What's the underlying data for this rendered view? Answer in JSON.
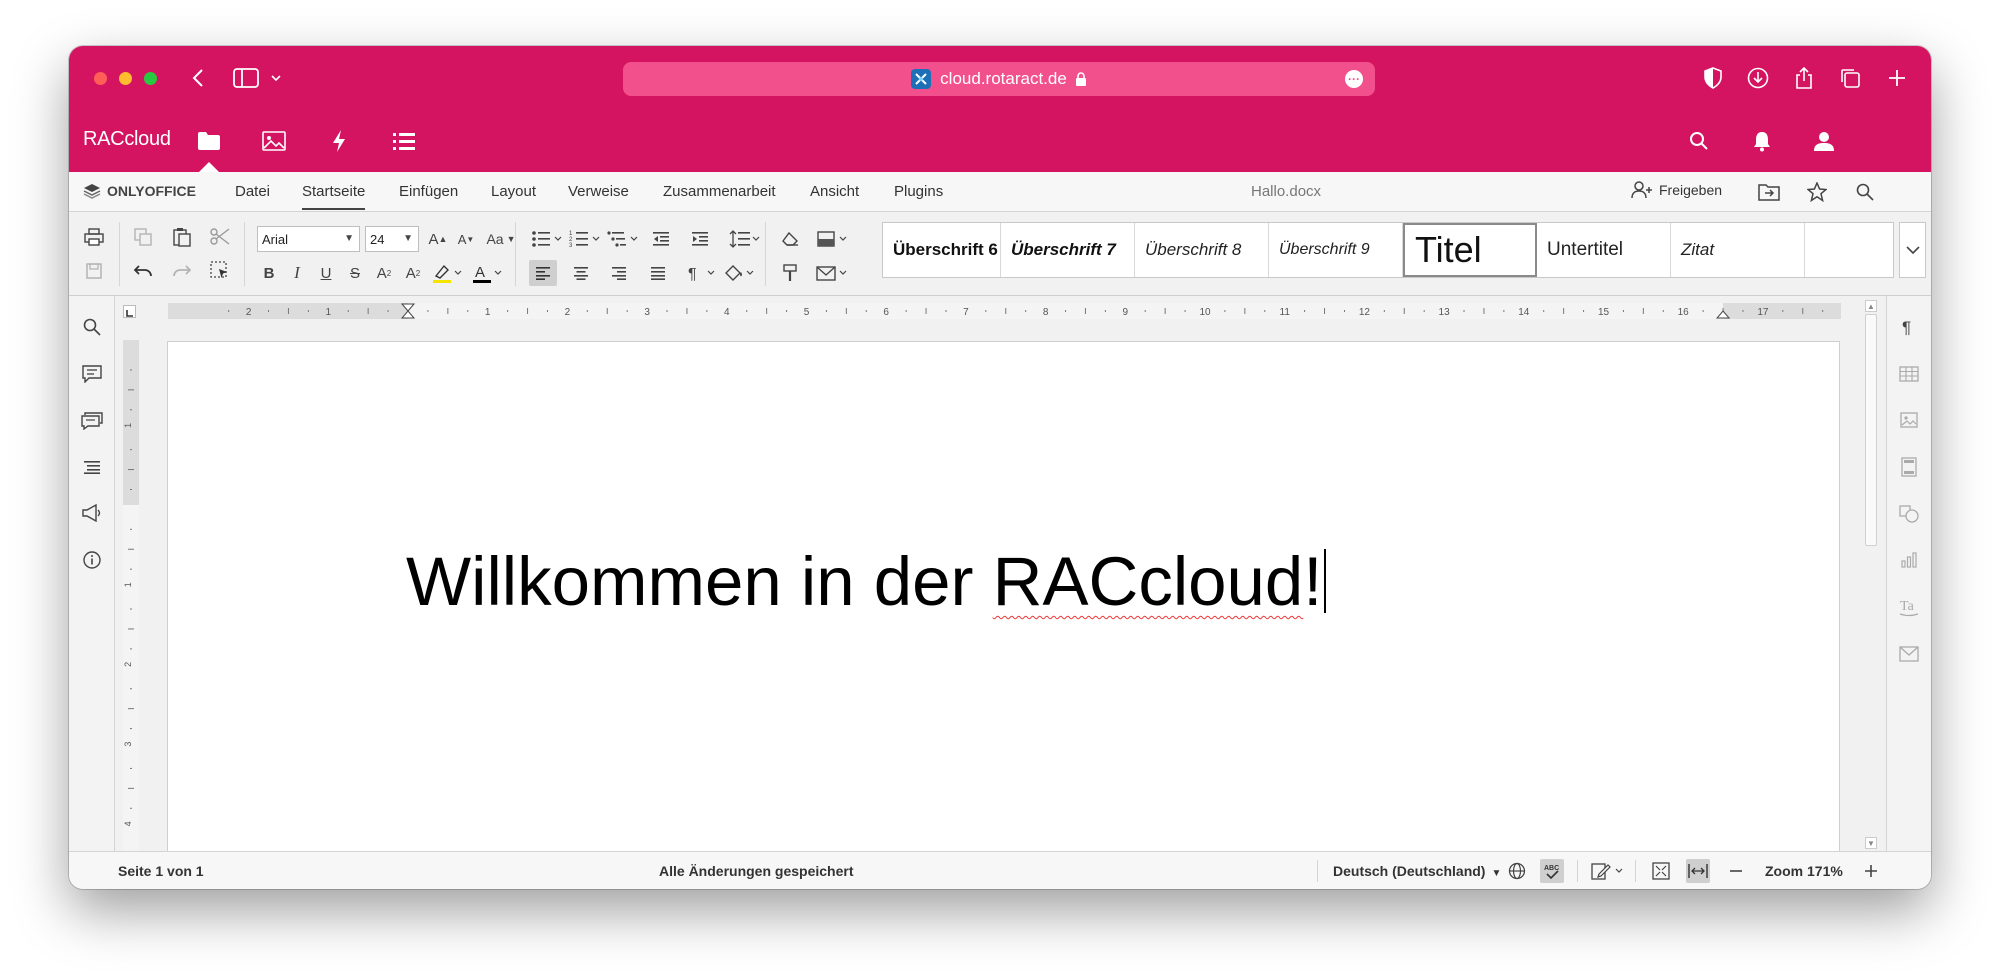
{
  "browser": {
    "url": "cloud.rotaract.de",
    "colors": {
      "chrome": "#d41461",
      "urlbar": "#f24f8d"
    }
  },
  "app": {
    "logo": "RACcloud",
    "nav_icons": [
      "folder-icon",
      "image-icon",
      "bolt-icon",
      "list-icon"
    ],
    "right_icons": [
      "search-icon",
      "bell-icon",
      "user-icon"
    ]
  },
  "editor": {
    "brand": "ONLYOFFICE",
    "tabs": [
      "Datei",
      "Startseite",
      "Einfügen",
      "Layout",
      "Verweise",
      "Zusammenarbeit",
      "Ansicht",
      "Plugins"
    ],
    "active_tab": "Startseite",
    "doc_title": "Hallo.docx",
    "share_label": "Freigeben"
  },
  "toolbar": {
    "font_name": "Arial",
    "font_size": "24",
    "styles": [
      "Überschrift 6",
      "Überschrift 7",
      "Überschrift 8",
      "Überschrift 9",
      "Titel",
      "Untertitel",
      "Zitat"
    ],
    "selected_style": "Titel"
  },
  "rulers": {
    "h_labels_left": [
      "2",
      "1"
    ],
    "h_labels": [
      "1",
      "2",
      "3",
      "4",
      "5",
      "6",
      "7",
      "8",
      "9",
      "10",
      "11",
      "12",
      "13",
      "14",
      "15",
      "16",
      "17"
    ],
    "v_labels": [
      "1",
      "1",
      "2",
      "3",
      "4"
    ]
  },
  "document": {
    "text_before": "Willkommen in der ",
    "text_misspelled": "RACcloud",
    "text_after": "!"
  },
  "status": {
    "page": "Seite 1 von 1",
    "save_state": "Alle Änderungen gespeichert",
    "language": "Deutsch (Deutschland)",
    "zoom": "Zoom 171%"
  }
}
